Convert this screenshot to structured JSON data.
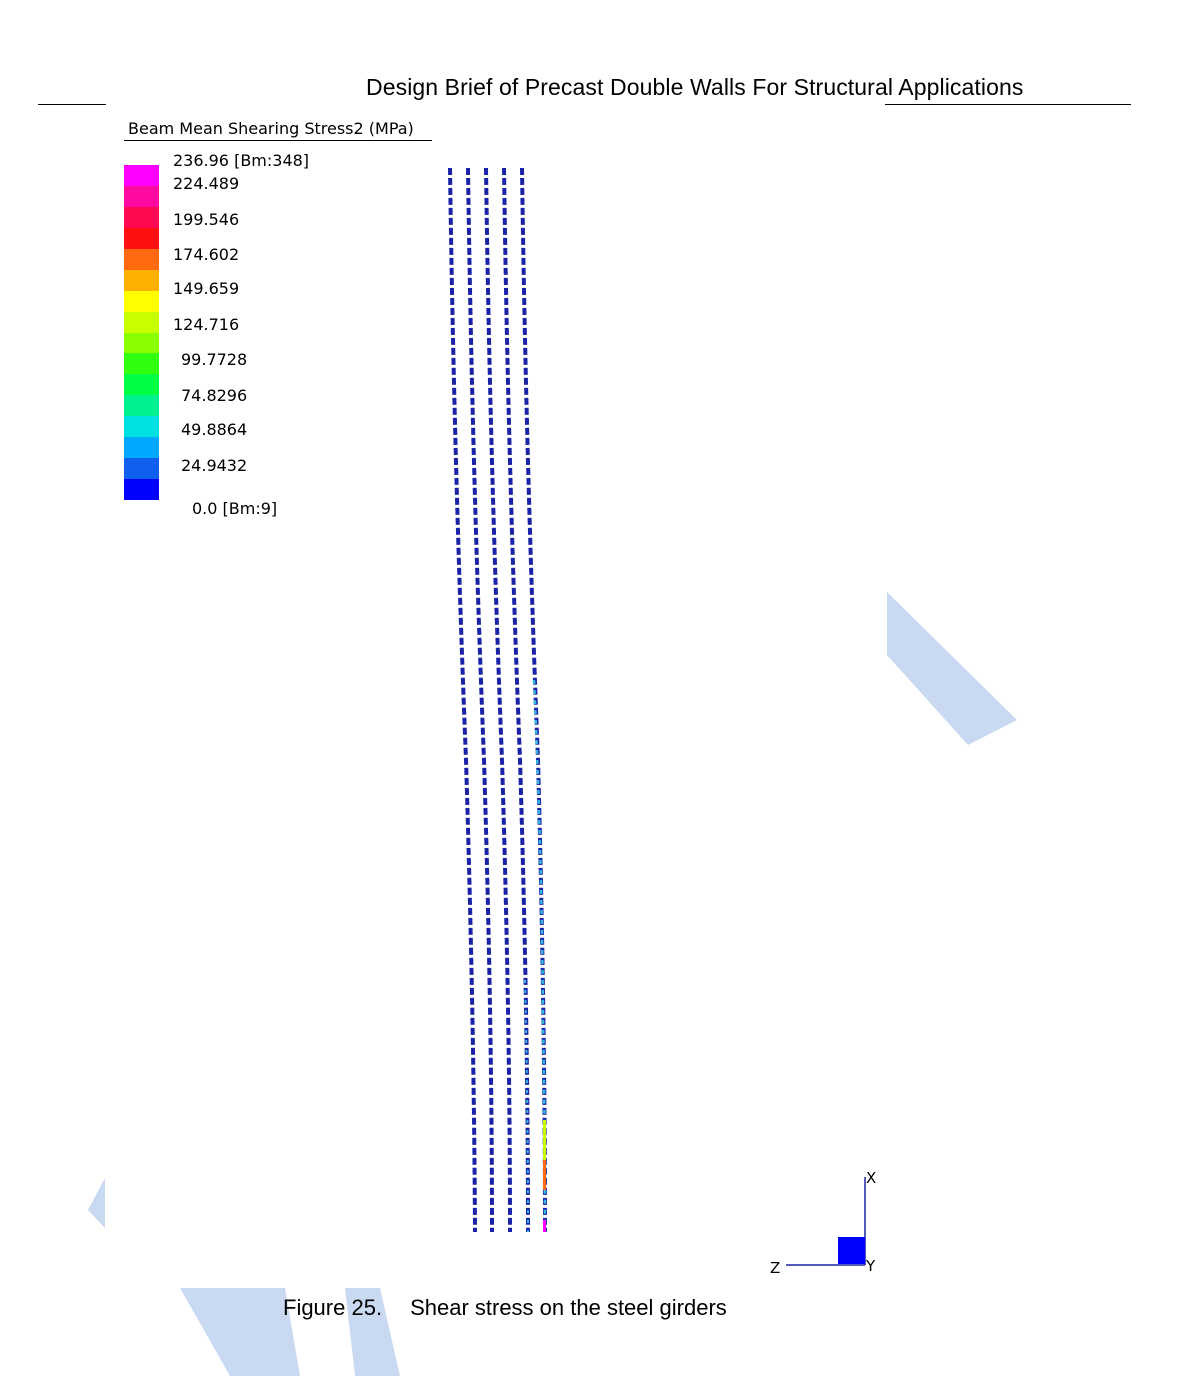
{
  "header": {
    "title": "Design Brief of Precast Double Walls For Structural Applications"
  },
  "legend": {
    "title": "Beam Mean Shearing Stress2  (MPa)",
    "max_label": "236.96 [Bm:348]",
    "min_label": "0.0 [Bm:9]",
    "values": [
      "224.489",
      "199.546",
      "174.602",
      "149.659",
      "124.716",
      "99.7728",
      "74.8296",
      "49.8864",
      "24.9432"
    ],
    "colors": [
      "#ff00ff",
      "#ff0aa0",
      "#ff0a50",
      "#ff1010",
      "#ff6a10",
      "#ffb000",
      "#ffff00",
      "#c8ff00",
      "#8aff00",
      "#30ff10",
      "#00ff40",
      "#00f090",
      "#00e0e0",
      "#00a8ff",
      "#1060f0",
      "#0000ff"
    ]
  },
  "axes": {
    "x": "X",
    "y": "Y",
    "z": "Z"
  },
  "caption": {
    "label": "Figure 25.",
    "text": "Shear stress on the steel girders"
  },
  "colors": {
    "girder": "#1a23a8",
    "girder_light": "#35b8e0",
    "watermark": "#c9d9f1",
    "triad_box": "#0000ff"
  }
}
